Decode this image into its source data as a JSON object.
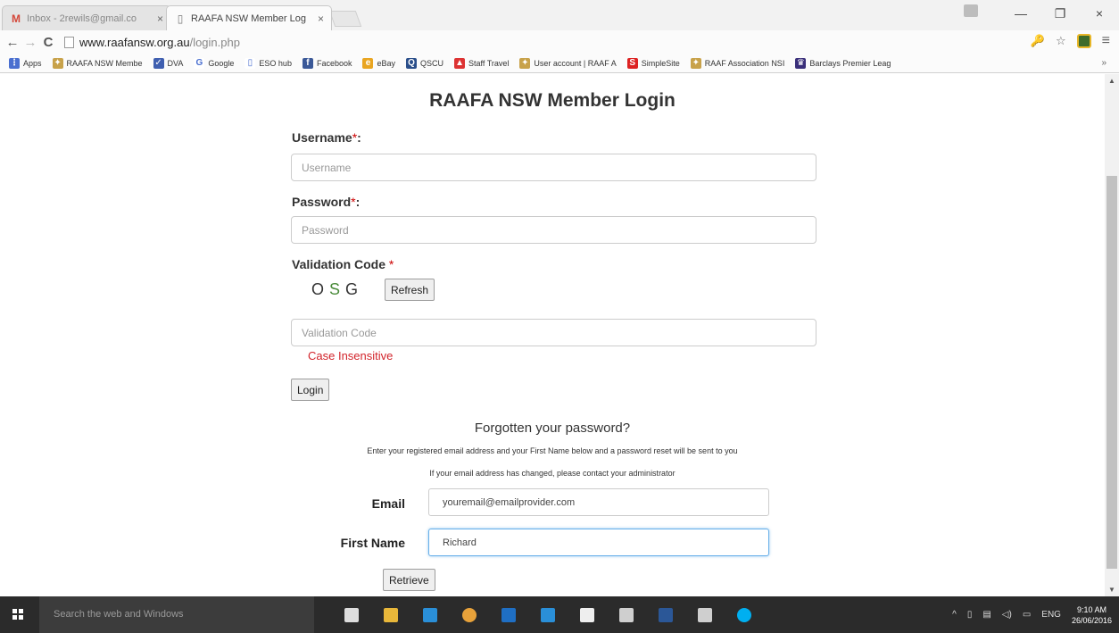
{
  "browser": {
    "tabs": [
      {
        "label": "Inbox - 2rewils@gmail.co",
        "favicon": "M",
        "close": "×"
      },
      {
        "label": "RAAFA NSW Member Log",
        "favicon": "▯",
        "close": "×"
      }
    ],
    "window_controls": {
      "minimize": "—",
      "restore": "❐",
      "close": "×"
    },
    "nav": {
      "back": "←",
      "forward": "→",
      "reload": "C"
    },
    "url_domain": "www.raafansw.org.au",
    "url_path": "/login.php",
    "toolbar_icons": {
      "key": "🔑",
      "star": "☆",
      "menu": "≡"
    },
    "bookmarks": [
      {
        "label": "Apps",
        "icon_color": "#4a6fd0",
        "glyph": "⋮"
      },
      {
        "label": "RAAFA NSW Membe",
        "icon_color": "#c8a24a",
        "glyph": "✦"
      },
      {
        "label": "DVA",
        "icon_color": "#3f5fb0",
        "glyph": "✓"
      },
      {
        "label": "Google",
        "icon_color": "#ffffff",
        "glyph": "G"
      },
      {
        "label": "ESO hub",
        "icon_color": "#ffffff",
        "glyph": "▯"
      },
      {
        "label": "Facebook",
        "icon_color": "#3b5998",
        "glyph": "f"
      },
      {
        "label": "eBay",
        "icon_color": "#e9a521",
        "glyph": "e"
      },
      {
        "label": "QSCU",
        "icon_color": "#2a4e8a",
        "glyph": "Q"
      },
      {
        "label": "Staff Travel",
        "icon_color": "#d33",
        "glyph": "▲"
      },
      {
        "label": "User account | RAAF A",
        "icon_color": "#c8a24a",
        "glyph": "✦"
      },
      {
        "label": "SimpleSite",
        "icon_color": "#d22",
        "glyph": "S"
      },
      {
        "label": "RAAF Association NSI",
        "icon_color": "#c8a24a",
        "glyph": "✦"
      },
      {
        "label": "Barclays Premier Leag",
        "icon_color": "#3a2f7a",
        "glyph": "♛"
      }
    ],
    "bookmarks_more": "»"
  },
  "page": {
    "title": "RAAFA NSW Member Login",
    "username_label": "Username",
    "username_placeholder": "Username",
    "password_label": "Password",
    "password_placeholder": "Password",
    "validation_label": "Validation Code",
    "required_mark": "*",
    "colon": ":",
    "captcha_chars": [
      "O",
      "S",
      "G"
    ],
    "refresh_label": "Refresh",
    "validation_placeholder": "Validation Code",
    "case_note": "Case Insensitive",
    "login_label": "Login",
    "forgot_title": "Forgotten your password?",
    "forgot_note_1": "Enter your registered email address and your First Name below and a password reset will be sent to you",
    "forgot_note_2": "If your email address has changed, please contact your administrator",
    "email_label": "Email",
    "email_value": "youremail@emailprovider.com",
    "first_name_label": "First Name",
    "first_name_value": "Richard",
    "retrieve_label": "Retrieve"
  },
  "taskbar": {
    "search_placeholder": "Search the web and Windows",
    "apps": [
      {
        "name": "task-view",
        "color": "#dddddd"
      },
      {
        "name": "file-explorer",
        "color": "#e8b73a"
      },
      {
        "name": "internet-explorer",
        "color": "#2a8fd8"
      },
      {
        "name": "chrome",
        "color": "#e8a23a"
      },
      {
        "name": "outlook",
        "color": "#1f6fc4"
      },
      {
        "name": "edge",
        "color": "#2a8fd8"
      },
      {
        "name": "store",
        "color": "#eeeeee"
      },
      {
        "name": "calculator",
        "color": "#cfcfcf"
      },
      {
        "name": "word",
        "color": "#2b5797"
      },
      {
        "name": "people",
        "color": "#cfcfcf"
      },
      {
        "name": "skype",
        "color": "#00aff0"
      }
    ],
    "tray_language": "ENG",
    "clock_time": "9:10 AM",
    "clock_date": "26/06/2016"
  }
}
